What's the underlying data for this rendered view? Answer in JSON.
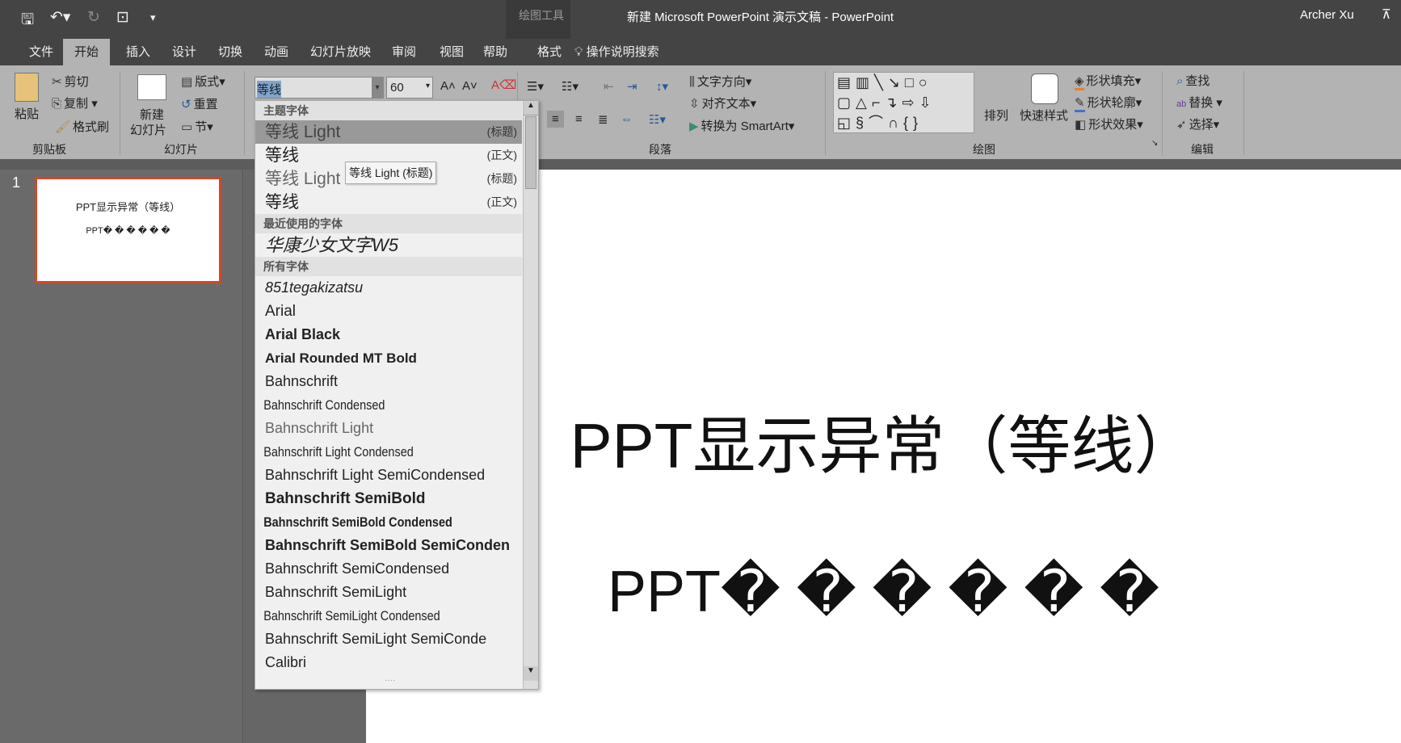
{
  "titlebar": {
    "context_tab": "绘图工具",
    "title": "新建 Microsoft PowerPoint 演示文稿  -  PowerPoint",
    "user": "Archer Xu"
  },
  "tabs": [
    {
      "label": "文件"
    },
    {
      "label": "开始"
    },
    {
      "label": "插入"
    },
    {
      "label": "设计"
    },
    {
      "label": "切换"
    },
    {
      "label": "动画"
    },
    {
      "label": "幻灯片放映"
    },
    {
      "label": "审阅"
    },
    {
      "label": "视图"
    },
    {
      "label": "帮助"
    },
    {
      "label": "格式"
    }
  ],
  "tell_me": "操作说明搜索",
  "ribbon": {
    "clipboard": {
      "paste": "粘贴",
      "cut": "剪切",
      "copy": "复制",
      "format_painter": "格式刷",
      "label": "剪贴板"
    },
    "slides": {
      "new_slide_1": "新建",
      "new_slide_2": "幻灯片",
      "layout": "版式",
      "reset": "重置",
      "section": "节",
      "label": "幻灯片"
    },
    "font": {
      "name": "等线",
      "size": "60"
    },
    "paragraph": {
      "text_direction": "文字方向",
      "align_text": "对齐文本",
      "convert_smartart": "转换为 SmartArt",
      "label": "段落"
    },
    "drawing": {
      "arrange": "排列",
      "quick_styles": "快速样式",
      "shape_fill": "形状填充",
      "shape_outline": "形状轮廓",
      "shape_effects": "形状效果",
      "label": "绘图",
      "fill_color": "#ed7d31",
      "outline_color": "#4472c4"
    },
    "editing": {
      "find": "查找",
      "replace": "替换",
      "select": "选择",
      "label": "编辑"
    }
  },
  "font_dropdown": {
    "theme_header": "主题字体",
    "theme_fonts": [
      {
        "name": "等线 Light",
        "tag": "(标题)"
      },
      {
        "name": "等线",
        "tag": "(正文)"
      },
      {
        "name": "等线 Light",
        "tag": "(标题)"
      },
      {
        "name": "等线",
        "tag": "(正文)"
      }
    ],
    "recent_header": "最近使用的字体",
    "recent_fonts": [
      "华康少女文字W5"
    ],
    "all_header": "所有字体",
    "all_fonts": [
      "851tegakizatsu",
      "Arial",
      "Arial Black",
      "Arial Rounded MT Bold",
      "Bahnschrift",
      "Bahnschrift Condensed",
      "Bahnschrift Light",
      "Bahnschrift Light Condensed",
      "Bahnschrift Light SemiCondensed",
      "Bahnschrift SemiBold",
      "Bahnschrift SemiBold Condensed",
      "Bahnschrift SemiBold SemiConden",
      "Bahnschrift SemiCondensed",
      "Bahnschrift SemiLight",
      "Bahnschrift SemiLight Condensed",
      "Bahnschrift SemiLight SemiConde",
      "Calibri"
    ],
    "tooltip": "等线 Light (标题)"
  },
  "thumbnails": [
    {
      "number": "1",
      "line1": "PPT显示异常（等线）",
      "line2": "PPT� � � � � �"
    }
  ],
  "slide": {
    "title": "PPT显示异常（等线）",
    "subtitle": "PPT� � � � � �",
    "selection_color": "#d24726"
  }
}
